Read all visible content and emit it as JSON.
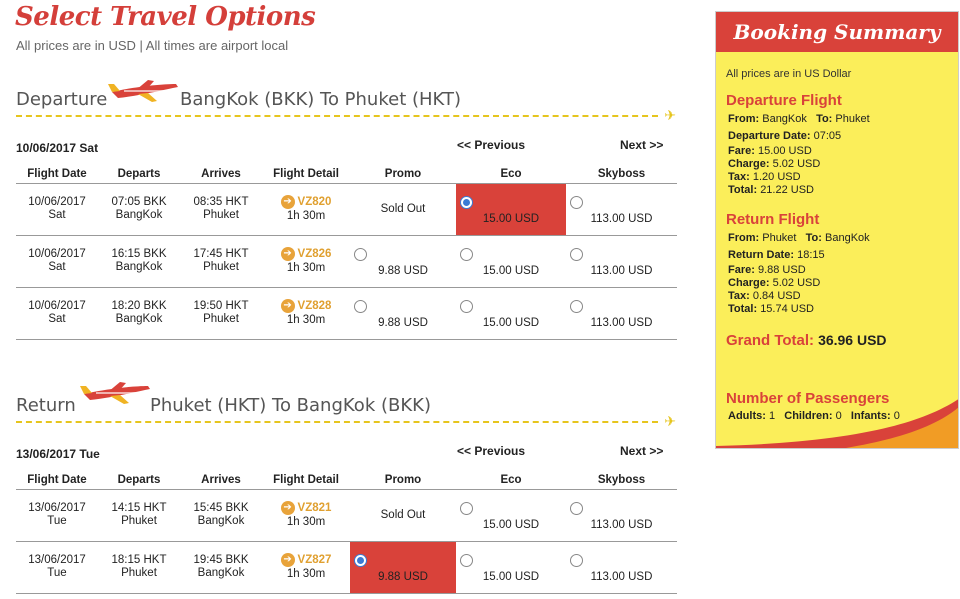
{
  "page": {
    "title": "Select Travel Options",
    "subtitle": "All prices are in USD | All times are airport local"
  },
  "departure": {
    "label": "Departure",
    "route": "BangKok (BKK) To Phuket (HKT)",
    "date": "10/06/2017 Sat",
    "prev": "<< Previous",
    "next": "Next >>",
    "headers": [
      "Flight Date",
      "Departs",
      "Arrives",
      "Flight Detail",
      "Promo",
      "Eco",
      "Skyboss"
    ],
    "rows": [
      {
        "date": "10/06/2017",
        "day": "Sat",
        "dep_time": "07:05 BKK",
        "dep_city": "BangKok",
        "arr_time": "08:35 HKT",
        "arr_city": "Phuket",
        "flight": "VZ820",
        "duration": "1h 30m",
        "promo": "Sold Out",
        "eco": "15.00 USD",
        "skyboss": "113.00 USD"
      },
      {
        "date": "10/06/2017",
        "day": "Sat",
        "dep_time": "16:15 BKK",
        "dep_city": "BangKok",
        "arr_time": "17:45 HKT",
        "arr_city": "Phuket",
        "flight": "VZ826",
        "duration": "1h 30m",
        "promo": "9.88 USD",
        "eco": "15.00 USD",
        "skyboss": "113.00 USD"
      },
      {
        "date": "10/06/2017",
        "day": "Sat",
        "dep_time": "18:20 BKK",
        "dep_city": "BangKok",
        "arr_time": "19:50 HKT",
        "arr_city": "Phuket",
        "flight": "VZ828",
        "duration": "1h 30m",
        "promo": "9.88 USD",
        "eco": "15.00 USD",
        "skyboss": "113.00 USD"
      }
    ]
  },
  "return": {
    "label": "Return",
    "route": "Phuket (HKT) To BangKok (BKK)",
    "date": "13/06/2017 Tue",
    "prev": "<< Previous",
    "next": "Next >>",
    "headers": [
      "Flight Date",
      "Departs",
      "Arrives",
      "Flight Detail",
      "Promo",
      "Eco",
      "Skyboss"
    ],
    "rows": [
      {
        "date": "13/06/2017",
        "day": "Tue",
        "dep_time": "14:15 HKT",
        "dep_city": "Phuket",
        "arr_time": "15:45 BKK",
        "arr_city": "BangKok",
        "flight": "VZ821",
        "duration": "1h 30m",
        "promo": "Sold Out",
        "eco": "15.00 USD",
        "skyboss": "113.00 USD"
      },
      {
        "date": "13/06/2017",
        "day": "Tue",
        "dep_time": "18:15 HKT",
        "dep_city": "Phuket",
        "arr_time": "19:45 BKK",
        "arr_city": "BangKok",
        "flight": "VZ827",
        "duration": "1h 30m",
        "promo": "9.88 USD",
        "eco": "15.00 USD",
        "skyboss": "113.00 USD"
      }
    ]
  },
  "summary": {
    "title": "Booking Summary",
    "note": "All prices are in US Dollar",
    "departure": {
      "title": "Departure Flight",
      "from_label": "From:",
      "from": "BangKok",
      "to_label": "To:",
      "to": "Phuket",
      "date_label": "Departure Date:",
      "date": "07:05",
      "fare_label": "Fare:",
      "fare": "15.00 USD",
      "charge_label": "Charge:",
      "charge": "5.02 USD",
      "tax_label": "Tax:",
      "tax": "1.20 USD",
      "total_label": "Total:",
      "total": "21.22 USD"
    },
    "return": {
      "title": "Return Flight",
      "from_label": "From:",
      "from": "Phuket",
      "to_label": "To:",
      "to": "BangKok",
      "date_label": "Return Date:",
      "date": "18:15",
      "fare_label": "Fare:",
      "fare": "9.88 USD",
      "charge_label": "Charge:",
      "charge": "5.02 USD",
      "tax_label": "Tax:",
      "tax": "0.84 USD",
      "total_label": "Total:",
      "total": "15.74 USD"
    },
    "grand_label": "Grand Total:",
    "grand_total": "36.96 USD",
    "passengers_title": "Number of Passengers",
    "adults_label": "Adults:",
    "adults": "1",
    "children_label": "Children:",
    "children": "0",
    "infants_label": "Infants:",
    "infants": "0"
  },
  "colors": {
    "accent_red": "#d9423a",
    "summary_yellow": "#fbee5a",
    "flight_code": "#e0a030",
    "dash": "#e6c51e"
  }
}
